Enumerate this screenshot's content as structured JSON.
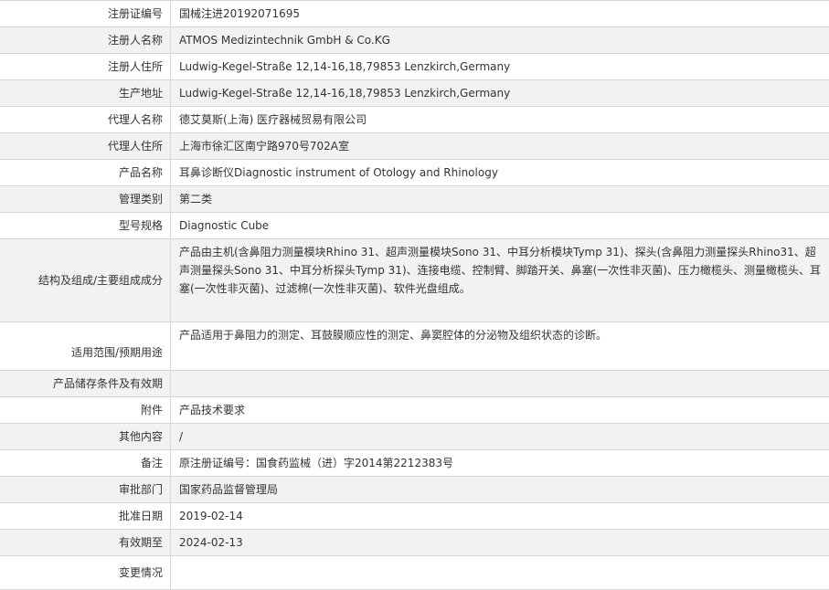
{
  "rows": [
    {
      "label": "注册证编号",
      "value": "国械注进20192071695"
    },
    {
      "label": "注册人名称",
      "value": "ATMOS Medizintechnik GmbH & Co.KG"
    },
    {
      "label": "注册人住所",
      "value": "Ludwig-Kegel-Straße 12,14-16,18,79853 Lenzkirch,Germany"
    },
    {
      "label": "生产地址",
      "value": "Ludwig-Kegel-Straße 12,14-16,18,79853 Lenzkirch,Germany"
    },
    {
      "label": "代理人名称",
      "value": "德艾莫斯(上海) 医疗器械贸易有限公司"
    },
    {
      "label": "代理人住所",
      "value": "上海市徐汇区南宁路970号702A室"
    },
    {
      "label": "产品名称",
      "value": "耳鼻诊断仪Diagnostic instrument of Otology and Rhinology"
    },
    {
      "label": "管理类别",
      "value": "第二类"
    },
    {
      "label": "型号规格",
      "value": "Diagnostic Cube"
    },
    {
      "label": "结构及组成/主要组成成分",
      "value": "产品由主机(含鼻阻力测量模块Rhino 31、超声测量模块Sono 31、中耳分析模块Tymp 31)、探头(含鼻阻力测量探头Rhino31、超声测量探头Sono 31、中耳分析探头Tymp 31)、连接电缆、控制臂、脚踏开关、鼻塞(一次性非灭菌)、压力橄榄头、测量橄榄头、耳塞(一次性非灭菌)、过滤棉(一次性非灭菌)、软件光盘组成。"
    },
    {
      "label": "适用范围/预期用途",
      "value": "产品适用于鼻阻力的测定、耳鼓膜顺应性的测定、鼻窦腔体的分泌物及组织状态的诊断。"
    },
    {
      "label": "产品储存条件及有效期",
      "value": ""
    },
    {
      "label": "附件",
      "value": "产品技术要求"
    },
    {
      "label": "其他内容",
      "value": "/"
    },
    {
      "label": "备注",
      "value": "原注册证编号：国食药监械（进）字2014第2212383号"
    },
    {
      "label": "审批部门",
      "value": "国家药品监督管理局"
    },
    {
      "label": "批准日期",
      "value": "2019-02-14"
    },
    {
      "label": "有效期至",
      "value": "2024-02-13"
    },
    {
      "label": "变更情况",
      "value": ""
    }
  ]
}
